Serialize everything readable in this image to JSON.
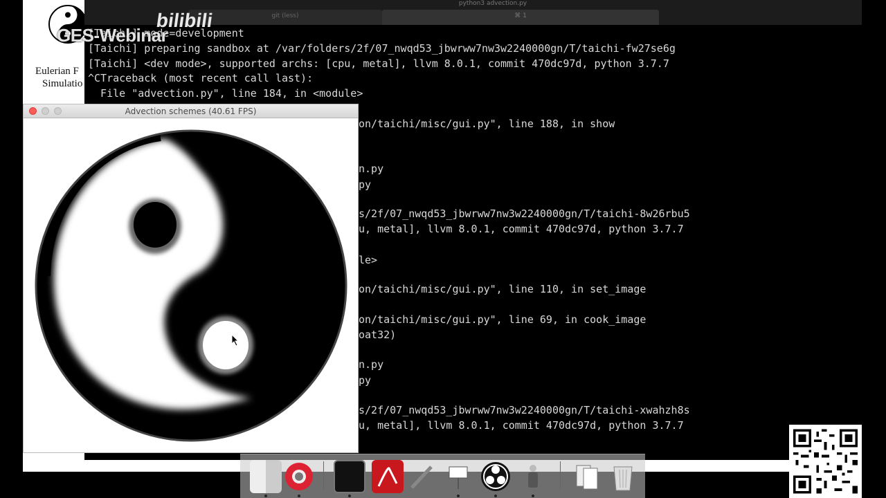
{
  "watermark": {
    "text": "GES-Webinar",
    "bilibili": "bilibili"
  },
  "slide": {
    "title_line1": "Eulerian F",
    "title_line2": "Simulatio"
  },
  "terminal": {
    "window_title": "python3 advection.py",
    "tab_left": "git (less)",
    "tab_right": "⌘ 1",
    "lines": [
      "[Taichi] mode=development",
      "[Taichi] preparing sandbox at /var/folders/2f/07_nwqd53_jbwrww7nw3w2240000gn/T/taichi-fw27se6g",
      "[Taichi] <dev mode>, supported archs: [cpu, metal], llvm 8.0.1, commit 470dc97d, python 3.7.7",
      "^CTraceback (most recent call last):",
      "  File \"advection.py\", line 184, in <module>",
      "on/taichi/misc/gui.py\", line 188, in show",
      "n.py",
      "py",
      "s/2f/07_nwqd53_jbwrww7nw3w2240000gn/T/taichi-8w26rbu5",
      "u, metal], llvm 8.0.1, commit 470dc97d, python 3.7.7",
      "le>",
      "on/taichi/misc/gui.py\", line 110, in set_image",
      "on/taichi/misc/gui.py\", line 69, in cook_image",
      "oat32)",
      "n.py",
      "py",
      "s/2f/07_nwqd53_jbwrww7nw3w2240000gn/T/taichi-xwahzh8s",
      "u, metal], llvm 8.0.1, commit 470dc97d, python 3.7.7"
    ]
  },
  "gui_window": {
    "title": "Advection schemes (40.61 FPS)"
  },
  "dock": {
    "items": [
      "finder-icon",
      "chrome-icon",
      "terminal-icon",
      "acrobat-icon",
      "pencil-icon",
      "keynote-icon",
      "obs-icon",
      "app-icon",
      "documents-icon",
      "trash-icon"
    ]
  },
  "colors": {
    "terminal_bg": "#000000",
    "terminal_text": "#d8d8d8",
    "close_button": "#fc5b57"
  }
}
